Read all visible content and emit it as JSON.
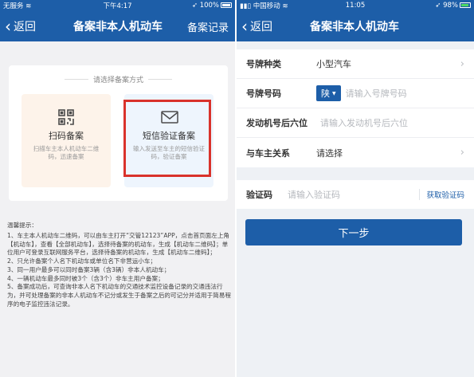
{
  "colors": {
    "brand": "#1d5ea8",
    "highlight": "#d9322b"
  },
  "left": {
    "status": {
      "carrier": "无服务",
      "time": "下午4:17",
      "battery": "100%"
    },
    "nav": {
      "back": "返回",
      "title": "备案非本人机动车",
      "right": "备案记录"
    },
    "method_title": "请选择备案方式",
    "options": [
      {
        "icon": "qr-code-icon",
        "label": "扫码备案",
        "desc": "扫描车主本人机动车二维码，迅速备案"
      },
      {
        "icon": "envelope-icon",
        "label": "短信验证备案",
        "desc": "输入发送至车主的短信验证码，验证备案"
      }
    ],
    "tips": {
      "title": "温馨提示：",
      "lines": [
        "1、车主本人机动车二维码，可以由车主打开“交管12123”APP，点击首页面左上角【机动车】，查看【全部机动车】，选择待备案的机动车，生成【机动车二维码】；单位用户可登录互联网服务平台，选择待备案的机动车，生成【机动车二维码】；",
        "2、只允许备案个人名下机动车或单位名下非营运小车；",
        "3、同一用户最多可以同时备案3辆（含3辆）非本人机动车；",
        "4、一辆机动车最多同时被3个（含3个）非车主用户备案；",
        "5、备案成功后，可查询非本人名下机动车的交通技术监控设备记录的交通违法行为，并可处理备案的非本人机动车不记分或发生于备案之后的可记分并适用于简易程序的电子监控违法记录。"
      ]
    }
  },
  "right": {
    "status": {
      "carrier": "中国移动",
      "time": "11:05",
      "battery": "98%"
    },
    "nav": {
      "back": "返回",
      "title": "备案非本人机动车"
    },
    "rows": {
      "plate_type": {
        "label": "号牌种类",
        "value": "小型汽车"
      },
      "plate_number": {
        "label": "号牌号码",
        "prefix": "陕",
        "placeholder": "请输入号牌号码"
      },
      "engine": {
        "label": "发动机号后六位",
        "placeholder": "请输入发动机号后六位"
      },
      "relation": {
        "label": "与车主关系",
        "value": "请选择"
      }
    },
    "code": {
      "label": "验证码",
      "placeholder": "请输入验证码",
      "button": "获取验证码"
    },
    "next": "下一步"
  }
}
